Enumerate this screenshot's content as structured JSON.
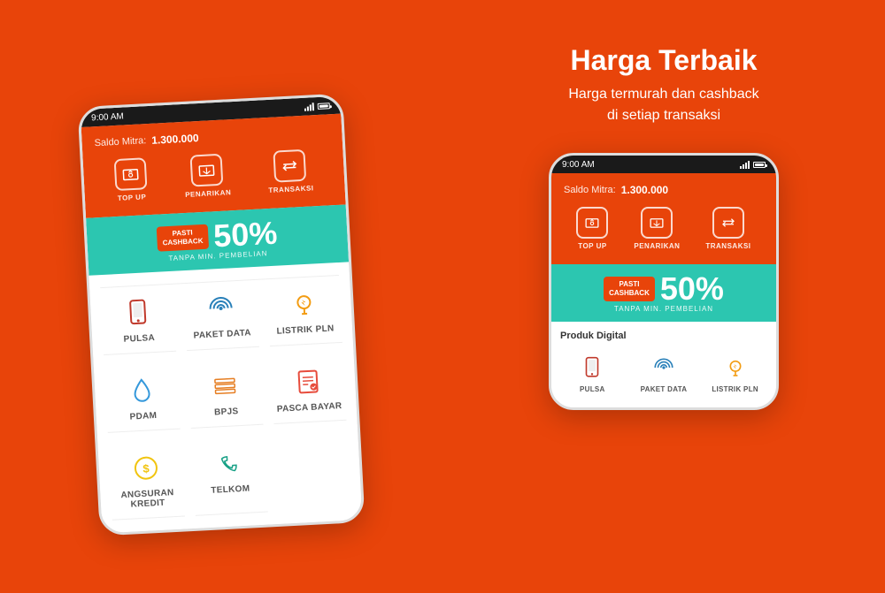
{
  "left": {
    "phone": {
      "status_bar": {
        "time": "9:00 AM"
      },
      "header": {
        "saldo_label": "Saldo Mitra:",
        "saldo_amount": "1.300.000"
      },
      "actions": [
        {
          "id": "topup",
          "label": "TOP UP",
          "icon": "wallet"
        },
        {
          "id": "penarikan",
          "label": "PENARIKAN",
          "icon": "bank"
        },
        {
          "id": "transaksi",
          "label": "TRANSAKSI",
          "icon": "transfer"
        }
      ],
      "cashback": {
        "badge_line1": "PASTI",
        "badge_line2": "CASHBACK",
        "percent": "50%",
        "sub": "TANPA MIN. PEMBELIAN"
      },
      "products": [
        {
          "id": "pulsa",
          "label": "PULSA",
          "icon": "📱",
          "color": "#c0392b"
        },
        {
          "id": "paket_data",
          "label": "PAKET DATA",
          "icon": "📶",
          "color": "#2980b9"
        },
        {
          "id": "listrik_pln",
          "label": "LISTRIK PLN",
          "icon": "💡",
          "color": "#f39c12"
        },
        {
          "id": "pdam",
          "label": "PDAM",
          "icon": "💧",
          "color": "#3498db"
        },
        {
          "id": "bpjs",
          "label": "BPJS",
          "icon": "🗂️",
          "color": "#e67e22"
        },
        {
          "id": "pasca_bayar",
          "label": "PASCA BAYAR",
          "icon": "📋",
          "color": "#e74c3c"
        },
        {
          "id": "angsuran_kredit",
          "label": "ANGSURAN KREDIT",
          "icon": "💰",
          "color": "#f1c40f"
        },
        {
          "id": "telkom",
          "label": "TELKOM",
          "icon": "☎️",
          "color": "#16a085"
        }
      ]
    }
  },
  "right": {
    "title": "Harga Terbaik",
    "subtitle": "Harga termurah dan cashback\ndi setiap transaksi",
    "phone": {
      "status_bar": {
        "time": "9:00 AM"
      },
      "header": {
        "saldo_label": "Saldo Mitra:",
        "saldo_amount": "1.300.000"
      },
      "actions": [
        {
          "id": "topup",
          "label": "TOP UP",
          "icon": "wallet"
        },
        {
          "id": "penarikan",
          "label": "PENARIKAN",
          "icon": "bank"
        },
        {
          "id": "transaksi",
          "label": "TRANSAKSI",
          "icon": "transfer"
        }
      ],
      "cashback": {
        "badge_line1": "PASTI",
        "badge_line2": "CASHBACK",
        "percent": "50%",
        "sub": "TANPA MIN. PEMBELIAN"
      },
      "produk_title": "Produk Digital",
      "products": [
        {
          "id": "pulsa",
          "label": "PULSA",
          "icon": "📱"
        },
        {
          "id": "paket_data",
          "label": "PAKET DATA",
          "icon": "📶"
        },
        {
          "id": "listrik_pln",
          "label": "LISTRIK PLN",
          "icon": "💡"
        }
      ]
    }
  }
}
